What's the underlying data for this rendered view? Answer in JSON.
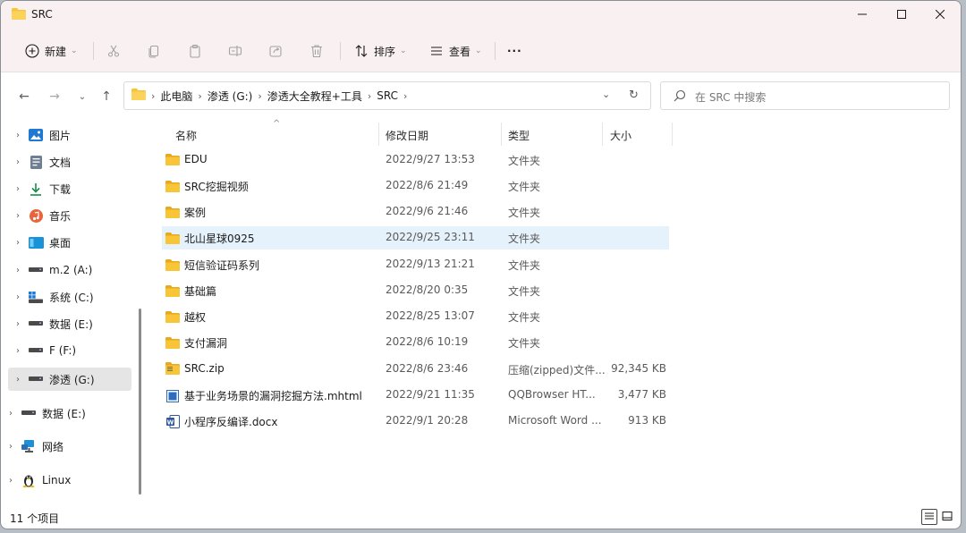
{
  "window": {
    "title": "SRC"
  },
  "toolbar": {
    "new_label": "新建",
    "sort_label": "排序",
    "view_label": "查看",
    "more_label": "···"
  },
  "address": {
    "crumbs": [
      "此电脑",
      "渗透 (G:)",
      "渗透大全教程+工具",
      "SRC"
    ]
  },
  "search": {
    "placeholder": "在 SRC 中搜索"
  },
  "nav": {
    "items": [
      {
        "label": "图片",
        "icon": "pictures-icon"
      },
      {
        "label": "文档",
        "icon": "documents-icon"
      },
      {
        "label": "下载",
        "icon": "download-icon"
      },
      {
        "label": "音乐",
        "icon": "music-icon"
      },
      {
        "label": "桌面",
        "icon": "desktop-icon"
      },
      {
        "label": "m.2 (A:)",
        "icon": "drive-icon"
      },
      {
        "label": "系统 (C:)",
        "icon": "windows-drive-icon"
      },
      {
        "label": "数据 (E:)",
        "icon": "drive-icon"
      },
      {
        "label": "F (F:)",
        "icon": "drive-icon"
      },
      {
        "label": "渗透 (G:)",
        "icon": "drive-icon"
      },
      {
        "label": "数据 (E:)",
        "icon": "drive-icon"
      },
      {
        "label": "网络",
        "icon": "network-icon"
      },
      {
        "label": "Linux",
        "icon": "linux-icon"
      }
    ]
  },
  "columns": {
    "name": "名称",
    "date": "修改日期",
    "type": "类型",
    "size": "大小"
  },
  "files": [
    {
      "name": "EDU",
      "date": "2022/9/27 13:53",
      "type": "文件夹",
      "size": "",
      "icon": "folder-icon"
    },
    {
      "name": "SRC挖掘视频",
      "date": "2022/8/6 21:49",
      "type": "文件夹",
      "size": "",
      "icon": "folder-icon"
    },
    {
      "name": "案例",
      "date": "2022/9/6 21:46",
      "type": "文件夹",
      "size": "",
      "icon": "folder-icon"
    },
    {
      "name": "北山星球0925",
      "date": "2022/9/25 23:11",
      "type": "文件夹",
      "size": "",
      "icon": "folder-icon"
    },
    {
      "name": "短信验证码系列",
      "date": "2022/9/13 21:21",
      "type": "文件夹",
      "size": "",
      "icon": "folder-icon"
    },
    {
      "name": "基础篇",
      "date": "2022/8/20 0:35",
      "type": "文件夹",
      "size": "",
      "icon": "folder-icon"
    },
    {
      "name": "越权",
      "date": "2022/8/25 13:07",
      "type": "文件夹",
      "size": "",
      "icon": "folder-icon"
    },
    {
      "name": "支付漏洞",
      "date": "2022/8/6 10:19",
      "type": "文件夹",
      "size": "",
      "icon": "folder-icon"
    },
    {
      "name": "SRC.zip",
      "date": "2022/8/6 23:46",
      "type": "压缩(zipped)文件...",
      "size": "92,345 KB",
      "icon": "zip-icon"
    },
    {
      "name": "基于业务场景的漏洞挖掘方法.mhtml",
      "date": "2022/9/21 11:35",
      "type": "QQBrowser HT...",
      "size": "3,477 KB",
      "icon": "mhtml-icon"
    },
    {
      "name": "小程序反编译.docx",
      "date": "2022/9/1 20:28",
      "type": "Microsoft Word ...",
      "size": "913 KB",
      "icon": "word-icon"
    }
  ],
  "status": {
    "count": "11 个项目"
  },
  "colors": {
    "titlebar": "#f9f0f1",
    "folder": "#f8c537",
    "selected_row": "#e5f1fb",
    "nav_selected": "#e5e5e5"
  }
}
